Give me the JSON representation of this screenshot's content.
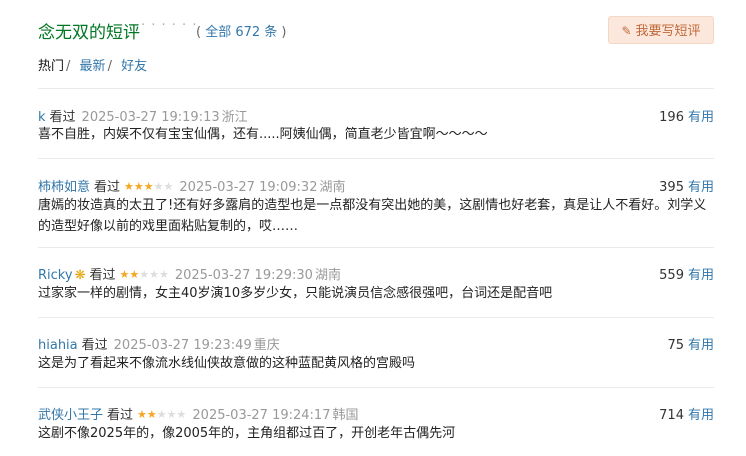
{
  "header": {
    "title": "念无双的短评",
    "dots": "· · · · · ·",
    "all_prefix": "( ",
    "all_label": "全部 672 条",
    "all_suffix": " )",
    "write_button": "我要写短评"
  },
  "tabs": [
    {
      "label": "热门",
      "sep": "/"
    },
    {
      "label": "最新",
      "sep": "/"
    },
    {
      "label": "好友",
      "sep": ""
    }
  ],
  "useful_label": "有用",
  "watched_label": "看过",
  "reviews": [
    {
      "user": "k",
      "stars": 0,
      "time": "2025-03-27 19:19:13",
      "location": "浙江",
      "votes": "196",
      "badge": "",
      "text": "喜不自胜，内娱不仅有宝宝仙偶，还有.....阿姨仙偶，简直老少皆宜啊～～～～"
    },
    {
      "user": "柿柿如意",
      "stars": 3,
      "time": "2025-03-27 19:09:32",
      "location": "湖南",
      "votes": "395",
      "badge": "",
      "text": "唐嫣的妆造真的太丑了!还有好多露肩的造型也是一点都没有突出她的美，这剧情也好老套，真是让人不看好。刘学义的造型好像以前的戏里面粘贴复制的，哎……"
    },
    {
      "user": "Ricky",
      "stars": 2,
      "time": "2025-03-27 19:29:30",
      "location": "湖南",
      "votes": "559",
      "badge": "❋",
      "text": "过家家一样的剧情，女主40岁演10多岁少女，只能说演员信念感很强吧，台词还是配音吧"
    },
    {
      "user": "hiahia",
      "stars": 0,
      "time": "2025-03-27 19:23:49",
      "location": "重庆",
      "votes": "75",
      "badge": "",
      "text": "这是为了看起来不像流水线仙侠故意做的这种蓝配黄风格的宫殿吗"
    },
    {
      "user": "武侠小王子",
      "stars": 2,
      "time": "2025-03-27 19:24:17",
      "location": "韩国",
      "votes": "714",
      "badge": "",
      "text": "这剧不像2025年的，像2005年的，主角组都过百了，开创老年古偶先河"
    }
  ]
}
